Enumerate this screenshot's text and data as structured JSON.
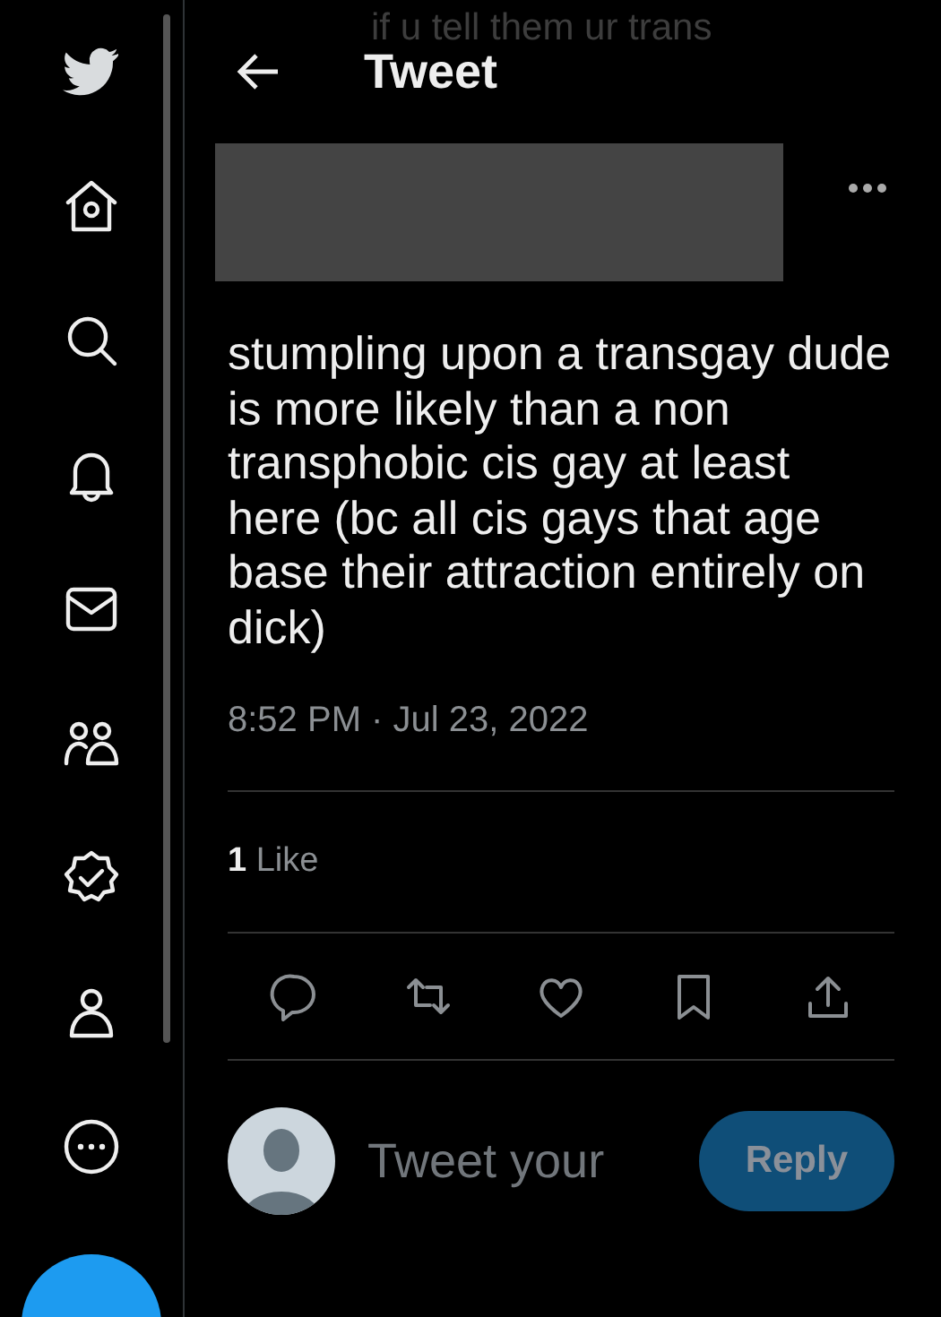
{
  "header": {
    "title": "Tweet",
    "behind_text": "if u tell them ur trans"
  },
  "tweet": {
    "text": "stumpling upon a transgay dude is more likely than a non transphobic cis gay at least here (bc all cis gays that age base their attraction entirely on dick)",
    "timestamp": "8:52 PM · Jul 23, 2022"
  },
  "stats": [
    {
      "count": "1",
      "label": "Like"
    }
  ],
  "reply": {
    "placeholder": "Tweet your",
    "button": "Reply",
    "disabled": true
  }
}
